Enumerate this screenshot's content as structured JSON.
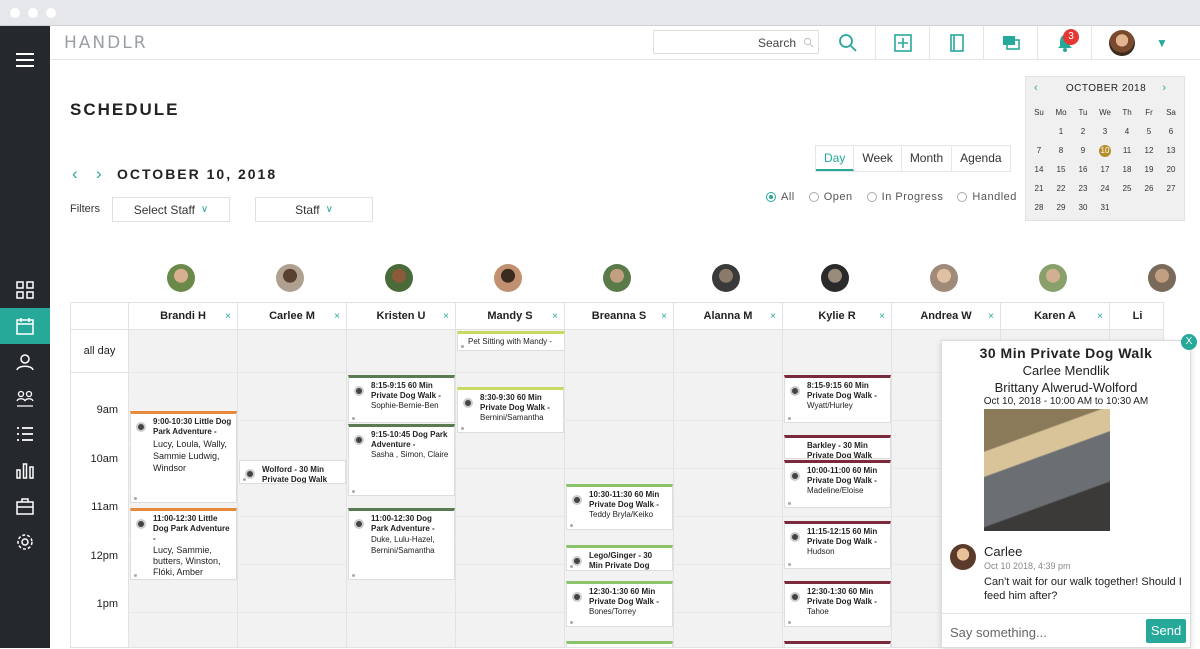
{
  "app": {
    "logo": "HANDLR"
  },
  "search": {
    "placeholder": "Search"
  },
  "notifications": {
    "count": "3"
  },
  "page": {
    "title": "SCHEDULE",
    "date": "OCTOBER 10, 2018",
    "filters_label": "Filters",
    "select_staff": "Select Staff",
    "staff": "Staff"
  },
  "views": [
    "Day",
    "Week",
    "Month",
    "Agenda"
  ],
  "status_filters": [
    "All",
    "Open",
    "In Progress",
    "Handled"
  ],
  "mini_calendar": {
    "month": "OCTOBER  2018",
    "weekdays": [
      "Su",
      "Mo",
      "Tu",
      "We",
      "Th",
      "Fr",
      "Sa"
    ],
    "days": [
      "",
      "1",
      "2",
      "3",
      "4",
      "5",
      "6",
      "7",
      "8",
      "9",
      "10",
      "11",
      "12",
      "13",
      "14",
      "15",
      "16",
      "17",
      "18",
      "19",
      "20",
      "21",
      "22",
      "23",
      "24",
      "25",
      "26",
      "27",
      "28",
      "29",
      "30",
      "31",
      "",
      "",
      ""
    ]
  },
  "calendar": {
    "allday_label": "all day",
    "times": [
      "9am",
      "10am",
      "11am",
      "12pm",
      "1pm"
    ],
    "staff": [
      "Brandi H",
      "Carlee M",
      "Kristen U",
      "Mandy S",
      "Breanna S",
      "Alanna M",
      "Kylie R",
      "Andrea W",
      "Karen A",
      "Li"
    ],
    "allday_events": [
      "Pet Sitting with Mandy -"
    ],
    "events": [
      {
        "title": "9:00-10:30 Little Dog Park Adventure -",
        "detail": "Lucy, Loula, Wally, Sammie Ludwig, Windsor"
      },
      {
        "title": "11:00-12:30 Little Dog Park Adventure -",
        "detail": "Lucy, Sammie, butters, Winston, Flóki, Amber"
      },
      {
        "title": "Wolford  -  30 Min Private Dog Walk",
        "detail": ""
      },
      {
        "title": "8:15-9:15 60 Min Private Dog Walk -",
        "detail": "Sophie-Bernie-Ben"
      },
      {
        "title": "9:15-10:45 Dog Park Adventure -",
        "detail": "Sasha , Simon, Claire"
      },
      {
        "title": "11:00-12:30 Dog Park Adventure -",
        "detail": "Duke, Lulu-Hazel, Bernini/Samantha"
      },
      {
        "title": "8:30-9:30 60 Min Private Dog Walk -",
        "detail": "Bernini/Samantha"
      },
      {
        "title": "10:30-11:30 60 Min Private Dog Walk -",
        "detail": "Teddy Bryla/Keiko"
      },
      {
        "title": "Lego/Ginger  -  30 Min Private Dog Walk",
        "detail": ""
      },
      {
        "title": "12:30-1:30 60 Min Private Dog Walk -",
        "detail": "Bones/Torrey"
      },
      {
        "title": "8:15-9:15 60 Min Private Dog Walk -",
        "detail": "Wyatt/Hurley"
      },
      {
        "title": "Barkley  -  30 Min Private Dog Walk",
        "detail": ""
      },
      {
        "title": "10:00-11:00 60 Min Private Dog Walk -",
        "detail": "Madeline/Eloise"
      },
      {
        "title": "11:15-12:15 60 Min Private Dog Walk -",
        "detail": "Hudson"
      },
      {
        "title": "12:30-1:30 60 Min Private Dog Walk -",
        "detail": "Tahoe"
      }
    ]
  },
  "popup": {
    "title": "30 Min Private Dog Walk",
    "staff": "Carlee Mendlik",
    "client": "Brittany Alwerud-Wolford",
    "when": "Oct 10, 2018 - 10:00 AM to 10:30 AM",
    "close": "X",
    "comment": {
      "author": "Carlee",
      "time": "Oct 10 2018, 4:39 pm",
      "text": "Can't wait for our walk together! Should I feed him after?"
    },
    "input_placeholder": "Say something...",
    "send": "Send"
  },
  "colors": {
    "accent": "#27a99a",
    "orange": "#e8883a",
    "green": "#5a7a52",
    "lime": "#c9d860",
    "lightgreen": "#8cc26a",
    "maroon": "#7a2a3a",
    "sidebar": "#25292e"
  }
}
